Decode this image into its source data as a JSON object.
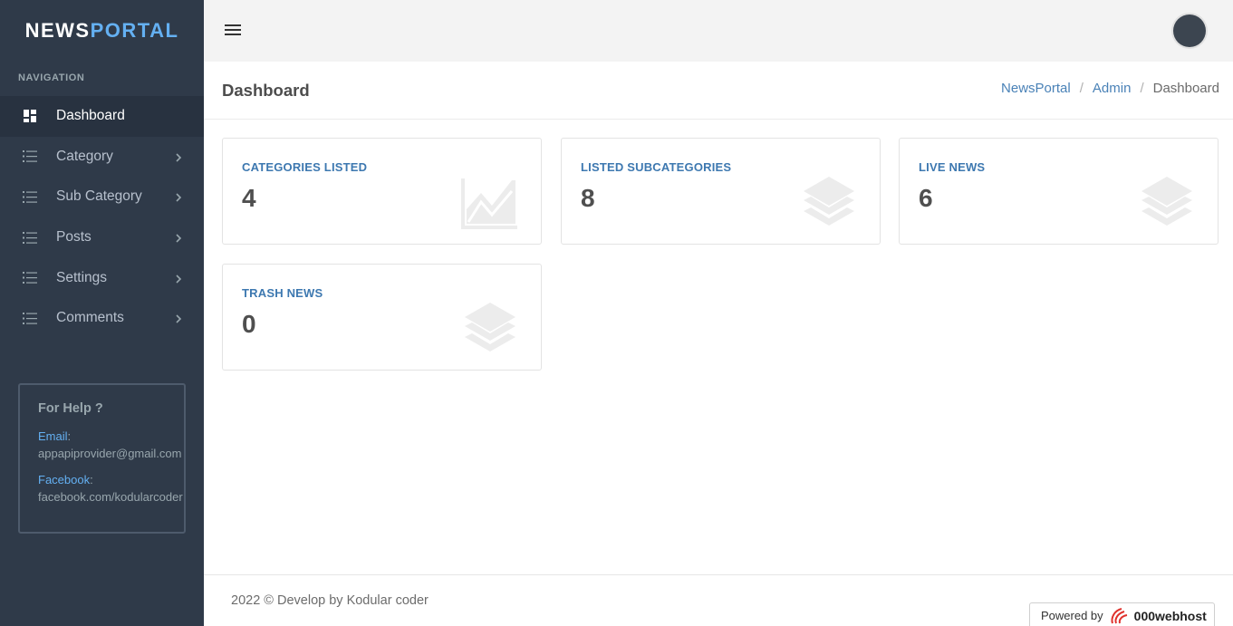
{
  "brand": {
    "part1": "NEWS",
    "part2": "PORTAL"
  },
  "sidebar": {
    "nav_title": "NAVIGATION",
    "items": [
      {
        "label": "Dashboard",
        "icon": "dashboard-icon",
        "active": true
      },
      {
        "label": "Category",
        "icon": "list-icon"
      },
      {
        "label": "Sub Category",
        "icon": "list-icon"
      },
      {
        "label": "Posts",
        "icon": "list-icon"
      },
      {
        "label": "Settings",
        "icon": "list-icon"
      },
      {
        "label": "Comments",
        "icon": "list-icon"
      }
    ],
    "help": {
      "title": "For Help ?",
      "email_label": "Email",
      "email": "appapiprovider@gmail.com",
      "facebook_label": "Facebook",
      "facebook": "facebook.com/kodularcoder"
    }
  },
  "header": {
    "menu_icon": "hamburger-icon",
    "avatar_icon": "user-avatar"
  },
  "page": {
    "title": "Dashboard",
    "breadcrumb": [
      "NewsPortal",
      "Admin",
      "Dashboard"
    ]
  },
  "cards": [
    {
      "title": "CATEGORIES LISTED",
      "value": "4",
      "icon": "area-chart-icon"
    },
    {
      "title": "LISTED SUBCATEGORIES",
      "value": "8",
      "icon": "layers-icon"
    },
    {
      "title": "LIVE NEWS",
      "value": "6",
      "icon": "layers-icon"
    },
    {
      "title": "TRASH NEWS",
      "value": "0",
      "icon": "layers-icon"
    }
  ],
  "footer": {
    "text": "2022 © Develop by Kodular coder",
    "powered_label": "Powered by",
    "host_name": "000webhost"
  },
  "colors": {
    "sidebar_bg": "#2f3a49",
    "accent_blue": "#64b0f2",
    "card_title": "#3d78b0",
    "breadcrumb_link": "#4a82b7"
  }
}
